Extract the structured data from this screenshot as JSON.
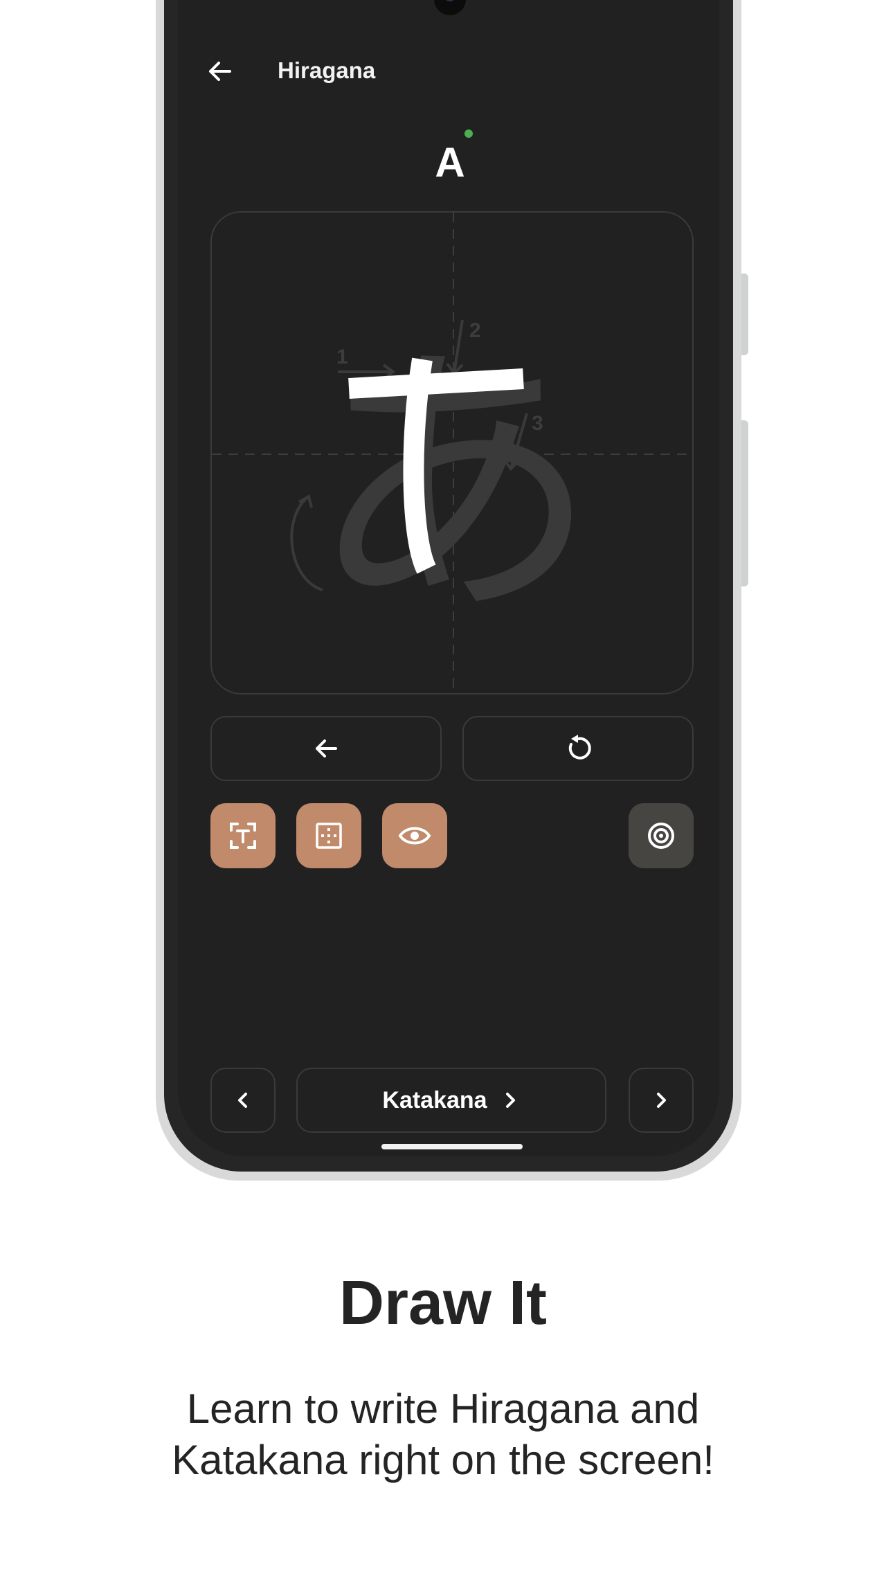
{
  "app_bar": {
    "title": "Hiragana",
    "back_icon": "arrow-left-icon"
  },
  "character": {
    "romaji": "A",
    "kana": "あ",
    "stroke_numbers": [
      "1",
      "2",
      "3"
    ],
    "status_color": "#4caf50"
  },
  "controls": {
    "undo_icon": "arrow-left-icon",
    "reset_icon": "reset-icon"
  },
  "tools": [
    {
      "name": "text-recognition",
      "icon": "text-scan-icon"
    },
    {
      "name": "grid",
      "icon": "grid-icon"
    },
    {
      "name": "show-guide",
      "icon": "eye-icon"
    },
    {
      "name": "target",
      "icon": "target-icon"
    }
  ],
  "navigation": {
    "prev_icon": "chevron-left-icon",
    "next_script_label": "Katakana",
    "next_icon": "chevron-right-icon"
  },
  "promo": {
    "headline": "Draw It",
    "subtext_line1": "Learn to write Hiragana and",
    "subtext_line2": "Katakana right on the screen!"
  },
  "colors": {
    "accent": "#c08a6b",
    "screen_bg": "#212121",
    "tool_inactive": "#474542"
  }
}
